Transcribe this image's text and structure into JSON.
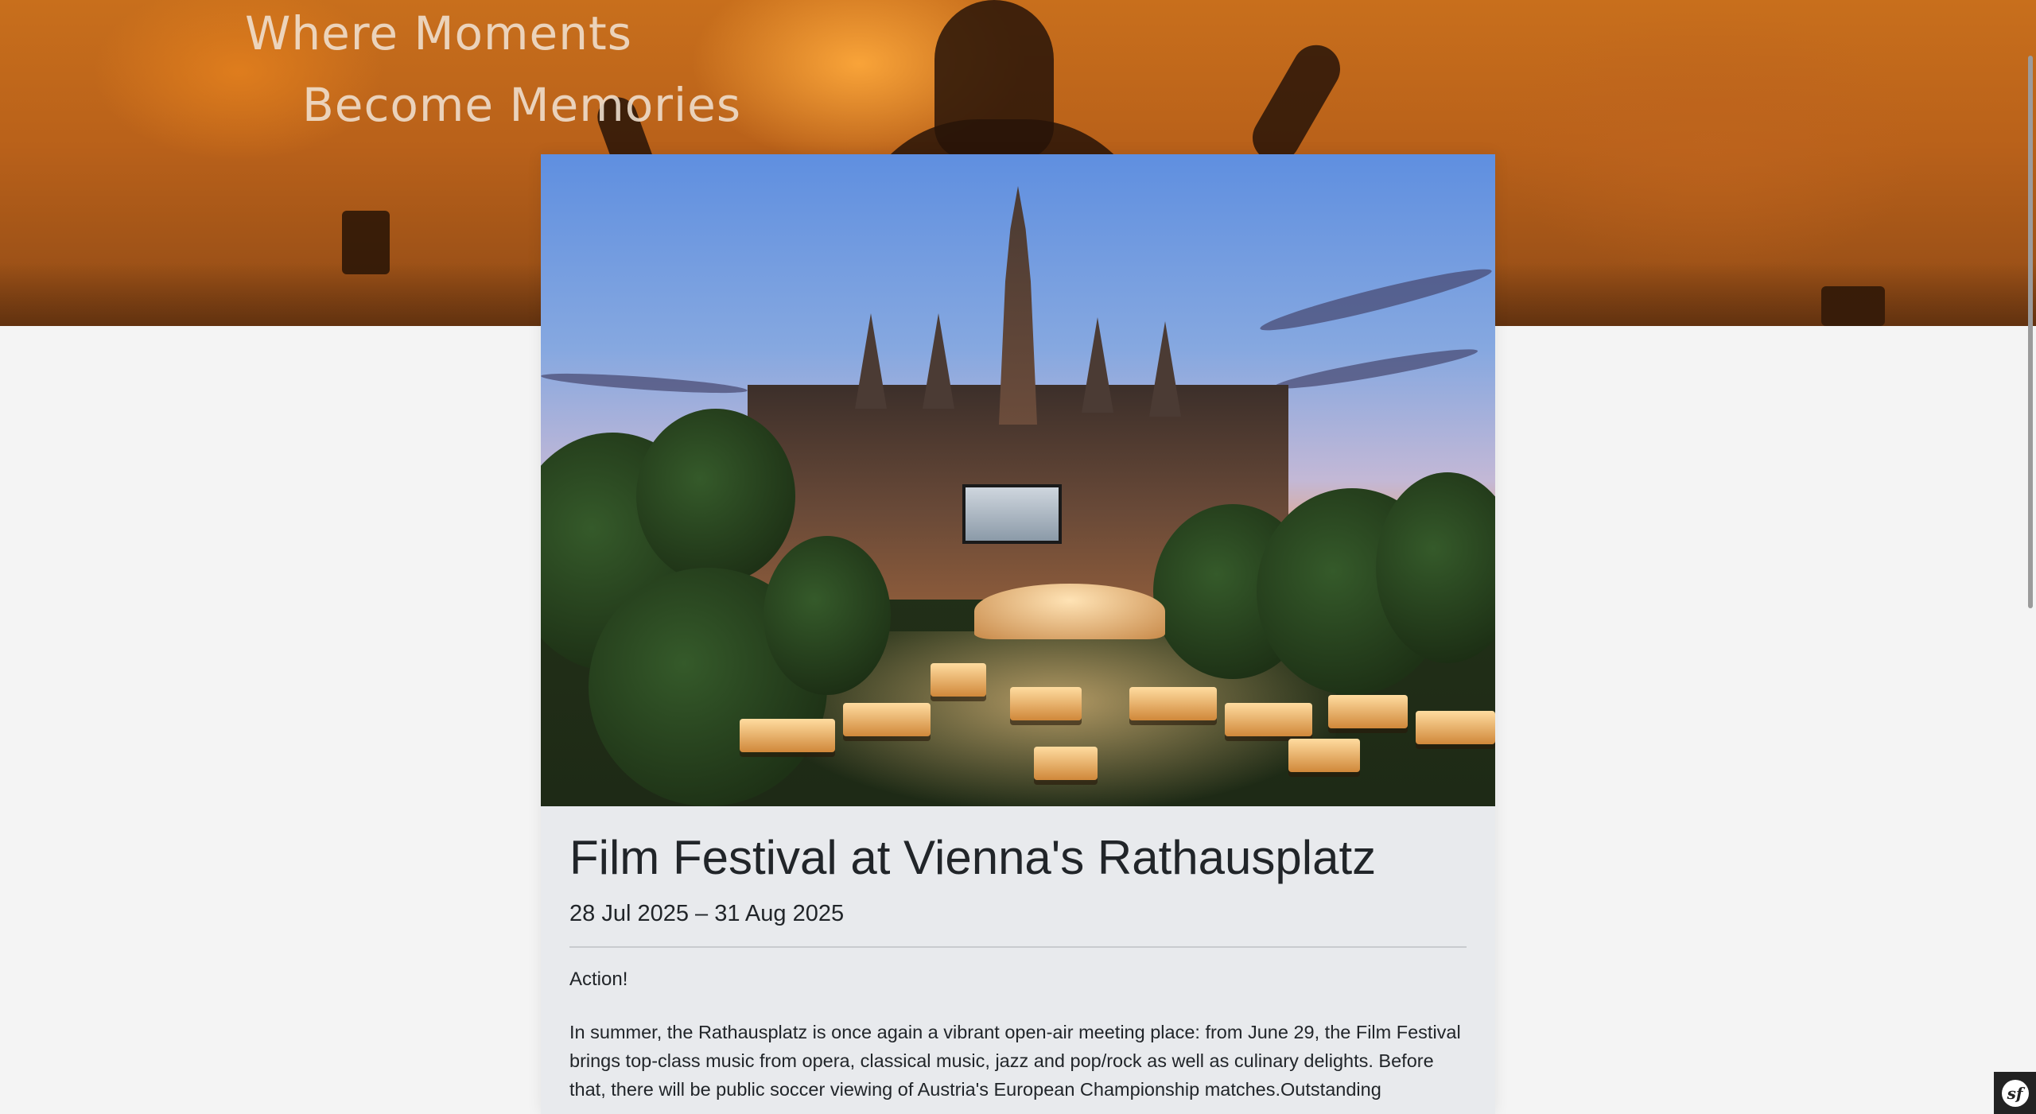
{
  "hero": {
    "tagline_line1": "Where Moments",
    "tagline_line2": "Become Memories"
  },
  "event": {
    "title": "Film Festival at Vienna's Rathausplatz",
    "dates": "28 Jul 2025 – 31 Aug 2025",
    "intro": "Action!",
    "description": "In summer, the Rathausplatz is once again a vibrant open-air meeting place: from June 29, the Film Festival brings top-class music from opera, classical music, jazz and pop/rock as well as culinary delights. Before that, there will be public soccer viewing of Austria's European Championship matches.Outstanding"
  },
  "toolbar": {
    "logo_glyph": "sf"
  },
  "colors": {
    "hero_orange": "#c86f1c",
    "card_background": "#e8eaed",
    "page_background": "#f4f4f4",
    "text": "#212529"
  }
}
